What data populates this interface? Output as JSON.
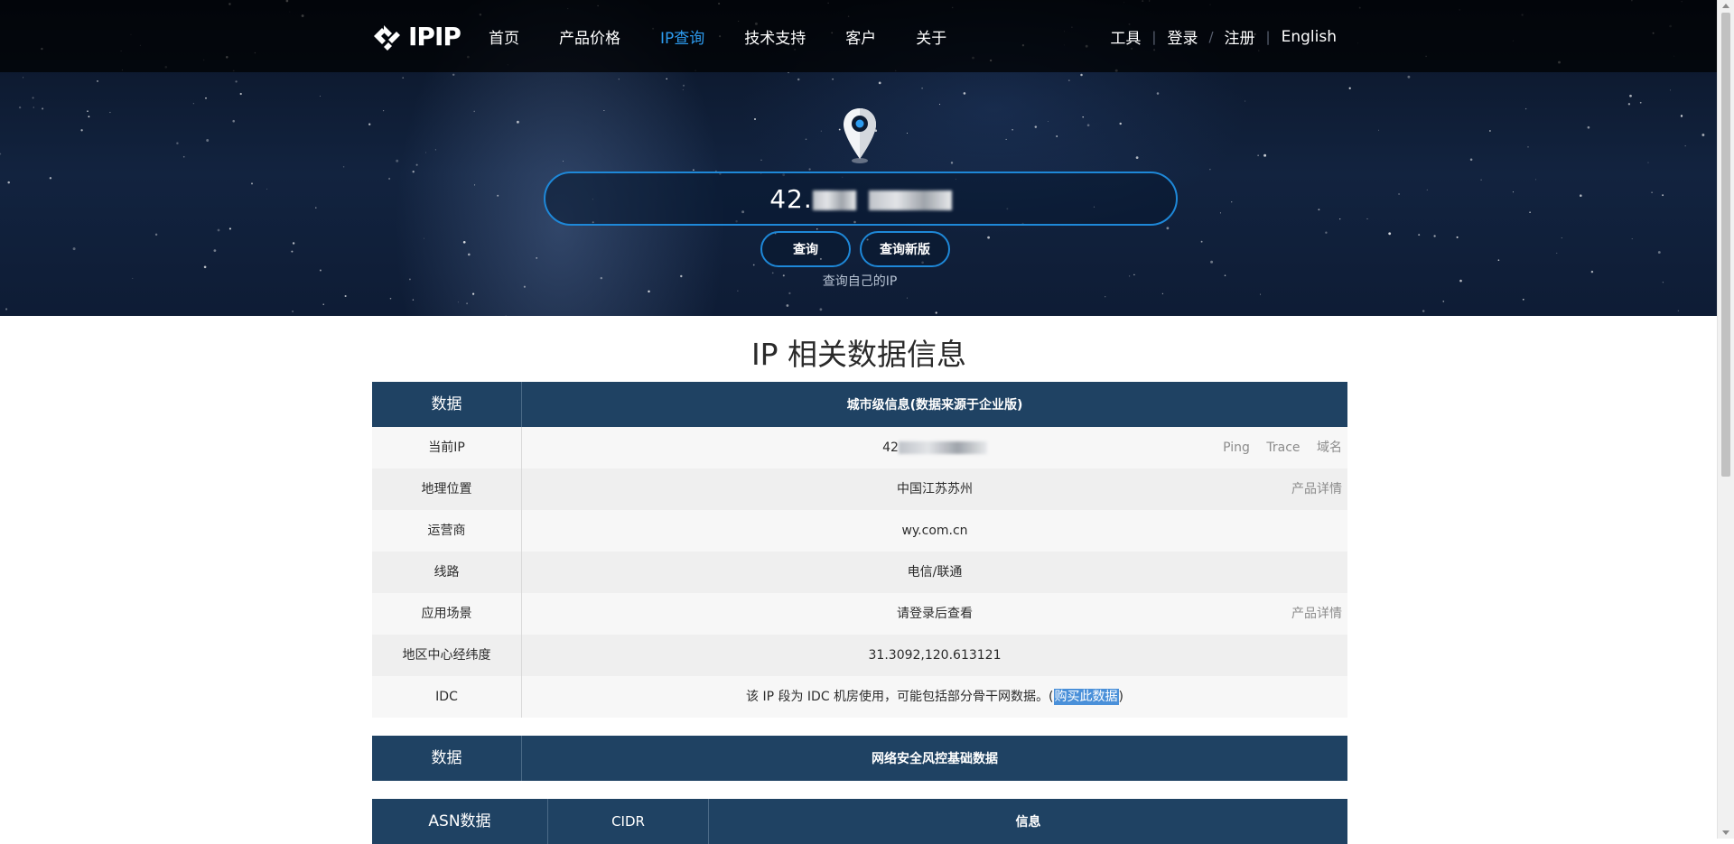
{
  "nav": {
    "logo_text": "IPIP",
    "items": [
      {
        "label": "首页",
        "active": false
      },
      {
        "label": "产品价格",
        "active": false
      },
      {
        "label": "IP查询",
        "active": true
      },
      {
        "label": "技术支持",
        "active": false
      },
      {
        "label": "客户",
        "active": false
      },
      {
        "label": "关于",
        "active": false
      }
    ],
    "right": {
      "tools": "工具",
      "login": "登录",
      "register": "注册",
      "english": "English"
    }
  },
  "hero": {
    "search_value_prefix": "42.",
    "query_button": "查询",
    "query_new_button": "查询新版",
    "my_ip_link": "查询自己的IP"
  },
  "main": {
    "title": "IP 相关数据信息",
    "table1": {
      "head_left": "数据",
      "head_main": "城市级信息(数据来源于企业版)",
      "rows": [
        {
          "label": "当前IP",
          "value": "42",
          "links": [
            "Ping",
            "Trace",
            "域名"
          ]
        },
        {
          "label": "地理位置",
          "value": "中国江苏苏州",
          "links": [
            "产品详情"
          ]
        },
        {
          "label": "运营商",
          "value": "wy.com.cn",
          "links": []
        },
        {
          "label": "线路",
          "value": "电信/联通",
          "links": []
        },
        {
          "label": "应用场景",
          "value": "请登录后查看",
          "links": [
            "产品详情"
          ]
        },
        {
          "label": "地区中心经纬度",
          "value": "31.3092,120.613121",
          "links": []
        },
        {
          "label": "IDC",
          "value": "该 IP 段为 IDC 机房使用，可能包括部分骨干网数据。(",
          "buy_link": "购买此数据",
          "value_suffix": ")",
          "links": []
        }
      ]
    },
    "table2": {
      "head_left": "数据",
      "head_main": "网络安全风控基础数据"
    },
    "table3": {
      "col1": "ASN数据",
      "col2": "CIDR",
      "col3": "信息"
    }
  },
  "colors": {
    "accent": "#1e88d8",
    "table_header": "#1f4263",
    "active_nav": "#2d9cf0"
  }
}
